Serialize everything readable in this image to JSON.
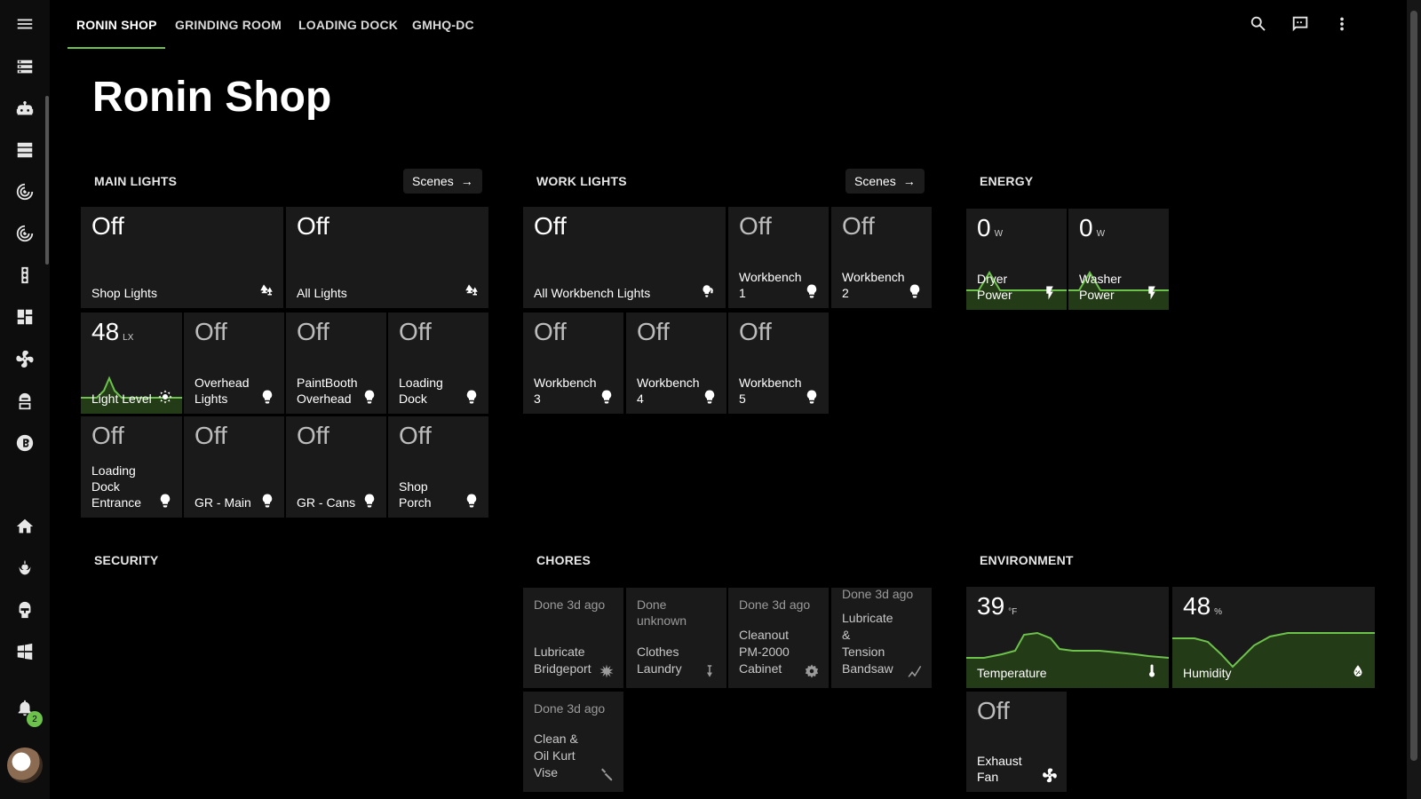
{
  "tabs": [
    {
      "label": "RONIN SHOP",
      "active": true
    },
    {
      "label": "GRINDING ROOM"
    },
    {
      "label": "LOADING DOCK"
    },
    {
      "label": "GMHQ-DC"
    }
  ],
  "sidebar": {
    "items": [
      "menu-icon",
      "server-icon",
      "robot-icon",
      "server-stack-icon",
      "radar-icon",
      "radar-icon-2",
      "traffic-light-icon",
      "dashboard-icon",
      "fan-icon",
      "astronaut-icon",
      "bitcoin-icon",
      "home-icon",
      "rebel-icon",
      "mandalorian-icon",
      "windows-icon",
      "bell-icon"
    ],
    "notifications": "2"
  },
  "page_title": "Ronin Shop",
  "sections": {
    "main_lights": {
      "title": "MAIN LIGHTS",
      "scenes": "Scenes"
    },
    "work_lights": {
      "title": "WORK LIGHTS",
      "scenes": "Scenes"
    },
    "energy": {
      "title": "ENERGY"
    },
    "security": {
      "title": "SECURITY"
    },
    "chores": {
      "title": "CHORES"
    },
    "environment": {
      "title": "ENVIRONMENT"
    }
  },
  "main_lights": [
    {
      "state": "Off",
      "label": "Shop Lights",
      "icon": "lamps-icon"
    },
    {
      "state": "Off",
      "label": "All Lights",
      "icon": "lamps-icon"
    },
    {
      "state": "48",
      "unit": "LX",
      "label": "Light Level",
      "icon": "brightness-icon",
      "sensor": true,
      "value": 48
    },
    {
      "state": "Off",
      "label": "Overhead\nLights",
      "icon": "bulb-icon"
    },
    {
      "state": "Off",
      "label": "PaintBooth\nOverhead",
      "icon": "bulb-icon"
    },
    {
      "state": "Off",
      "label": "Loading\nDock",
      "icon": "bulb-icon"
    },
    {
      "state": "Off",
      "label": "Loading\nDock\nEntrance",
      "icon": "bulb-icon"
    },
    {
      "state": "Off",
      "label": "GR - Main",
      "icon": "bulb-icon"
    },
    {
      "state": "Off",
      "label": "GR - Cans",
      "icon": "bulb-icon"
    },
    {
      "state": "Off",
      "label": "Shop\nPorch",
      "icon": "bulb-icon"
    }
  ],
  "work_lights": [
    {
      "state": "Off",
      "label": "All Workbench Lights",
      "icon": "bulb-group-icon"
    },
    {
      "state": "Off",
      "label": "Workbench\n1",
      "icon": "bulb-icon"
    },
    {
      "state": "Off",
      "label": "Workbench\n2",
      "icon": "bulb-icon"
    },
    {
      "state": "Off",
      "label": "Workbench\n3",
      "icon": "bulb-icon"
    },
    {
      "state": "Off",
      "label": "Workbench\n4",
      "icon": "bulb-icon"
    },
    {
      "state": "Off",
      "label": "Workbench\n5",
      "icon": "bulb-icon"
    }
  ],
  "energy": [
    {
      "state": "0",
      "unit": "W",
      "label": "Dryer\nPower",
      "icon": "flash-icon"
    },
    {
      "state": "0",
      "unit": "W",
      "label": "Washer\nPower",
      "icon": "flash-icon"
    }
  ],
  "chores": [
    {
      "state": "Done 3d ago",
      "label": "Lubricate\nBridgeport",
      "icon": "oil-splat-icon"
    },
    {
      "state": "Done\nunknown",
      "label": "Clothes\nLaundry",
      "icon": "iron-icon"
    },
    {
      "state": "Done 3d ago",
      "label": "Cleanout\nPM-2000\nCabinet",
      "icon": "saw-blade-icon"
    },
    {
      "state": "Done 3d ago",
      "label": "Lubricate\n&\nTension\nBandsaw",
      "icon": "zigzag-icon"
    },
    {
      "state": "Done 3d ago",
      "label": "Clean &\nOil Kurt\nVise",
      "icon": "wrench-icon"
    }
  ],
  "environment": [
    {
      "state": "39",
      "unit": "°F",
      "label": "Temperature",
      "icon": "thermometer-icon",
      "value": 39
    },
    {
      "state": "48",
      "unit": "%",
      "label": "Humidity",
      "icon": "water-percent-icon",
      "value": 48
    },
    {
      "state": "Off",
      "label": "Exhaust\nFan",
      "icon": "fan-icon"
    }
  ],
  "colors": {
    "accent": "#6cc24a",
    "tile": "#1a1a1a",
    "background": "#000000"
  }
}
